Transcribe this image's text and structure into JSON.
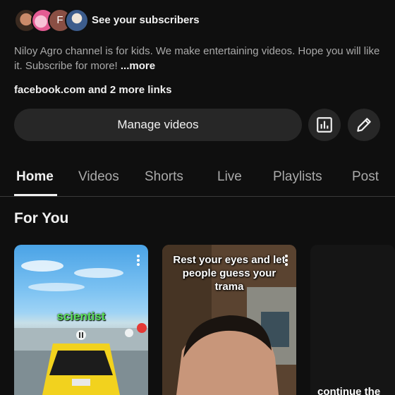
{
  "subscribers": {
    "avatar_letter": "F",
    "label": "See your subscribers"
  },
  "description": {
    "text": "Niloy Agro channel is for kids. We make entertaining videos. Hope you will like it. Subscribe for more!",
    "more": "...more"
  },
  "links": {
    "first": "facebook.com",
    "rest": " and 2 more links"
  },
  "actions": {
    "manage_label": "Manage videos",
    "stats_icon": "analytics-icon",
    "edit_icon": "pencil-icon"
  },
  "tabs": [
    {
      "label": "Home",
      "active": true
    },
    {
      "label": "Videos",
      "active": false
    },
    {
      "label": "Shorts",
      "active": false
    },
    {
      "label": "Live",
      "active": false
    },
    {
      "label": "Playlists",
      "active": false
    },
    {
      "label": "Post",
      "active": false
    }
  ],
  "section_title": "For You",
  "cards": [
    {
      "caption": "scientist"
    },
    {
      "caption": "Rest your eyes and let people guess your trama"
    },
    {
      "caption": "continue the"
    }
  ],
  "colors": {
    "background": "#0f0f0f",
    "button_bg": "#272727",
    "caption_green": "#5be35b"
  }
}
